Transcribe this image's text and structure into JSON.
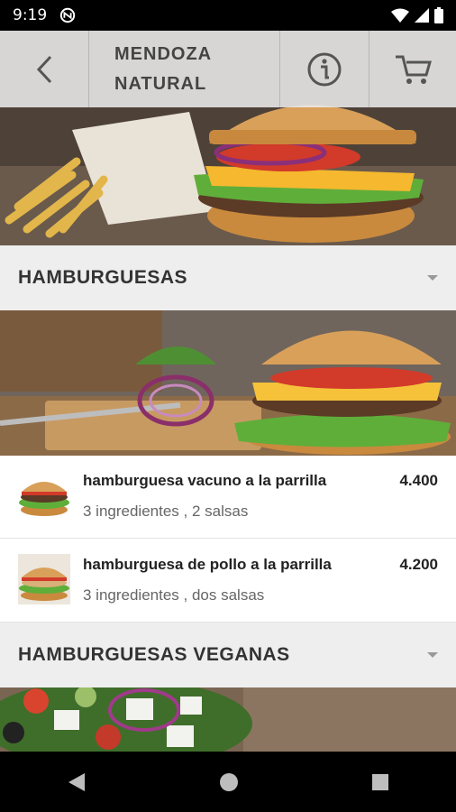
{
  "status": {
    "time": "9:19"
  },
  "toolbar": {
    "title": "MENDOZA\nNATURAL"
  },
  "categories": [
    {
      "name": "HAMBURGUESAS"
    },
    {
      "name": "HAMBURGUESAS VEGANAS"
    }
  ],
  "products": [
    {
      "name": "hamburguesa vacuno a la parrilla",
      "description": "3 ingredientes , 2 salsas",
      "price": "4.400"
    },
    {
      "name": "hamburguesa de pollo a la parrilla",
      "description": "3 ingredientes , dos salsas",
      "price": "4.200"
    }
  ],
  "colors": {
    "header_bg": "#eeeeee",
    "toolbar_bg": "#ebebeb"
  }
}
